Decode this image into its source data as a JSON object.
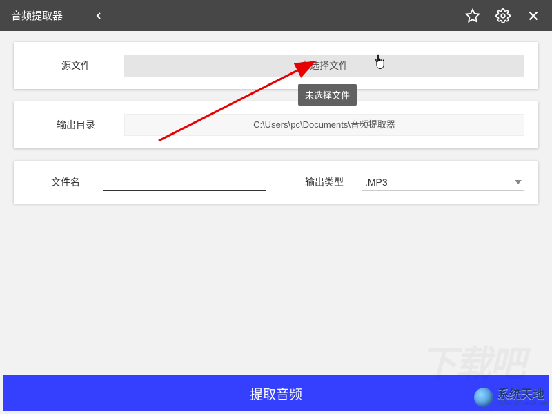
{
  "header": {
    "title": "音频提取器"
  },
  "source": {
    "label": "源文件",
    "button_text": "未选择文件",
    "tooltip": "未选择文件"
  },
  "output_dir": {
    "label": "输出目录",
    "value": "C:\\Users\\pc\\Documents\\音频提取器"
  },
  "filename": {
    "label": "文件名",
    "value": ""
  },
  "output_type": {
    "label": "输出类型",
    "selected": ".MP3"
  },
  "action": {
    "extract": "提取音频"
  },
  "watermark": {
    "main": "系统天地",
    "sub": "XiTongTianDi.net"
  }
}
